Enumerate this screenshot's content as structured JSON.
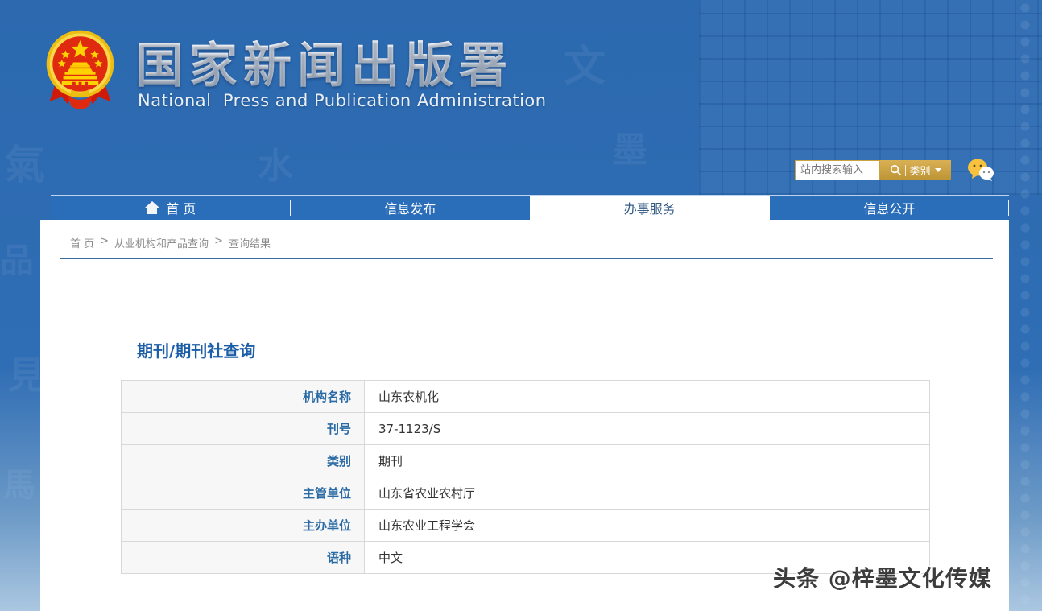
{
  "colors": {
    "header_blue": "#2c69af",
    "nav_blue": "#2a6db9",
    "accent_blue": "#1d5fa6",
    "gold": "#c9a23f",
    "label_blue": "#2a6aa5",
    "fade_light_blue": "#abc7e1"
  },
  "background": {
    "glyphs": [
      "氣",
      "品",
      "見",
      "馬",
      "文",
      "墨",
      "水"
    ]
  },
  "header": {
    "site_title": "国家新闻出版署",
    "site_subtitle": "National  Press and Publication Administration",
    "logo_name": "china-national-emblem",
    "search": {
      "placeholder": "站内搜索输入",
      "category_label": "类别"
    }
  },
  "nav": {
    "items": [
      {
        "label": "首 页",
        "active": false
      },
      {
        "label": "信息发布",
        "active": false
      },
      {
        "label": "办事服务",
        "active": true
      },
      {
        "label": "信息公开",
        "active": false
      }
    ]
  },
  "breadcrumb": {
    "separator": ">",
    "items": [
      "首 页",
      "从业机构和产品查询",
      "查询结果"
    ]
  },
  "main": {
    "section_title": "期刊/期刊社查询",
    "table": {
      "rows": [
        {
          "label": "机构名称",
          "value": "山东农机化"
        },
        {
          "label": "刊号",
          "value": "37-1123/S"
        },
        {
          "label": "类别",
          "value": "期刊"
        },
        {
          "label": "主管单位",
          "value": "山东省农业农村厅"
        },
        {
          "label": "主办单位",
          "value": "山东农业工程学会"
        },
        {
          "label": "语种",
          "value": "中文"
        }
      ]
    }
  },
  "watermark": {
    "text": "头条 @梓墨文化传媒"
  }
}
